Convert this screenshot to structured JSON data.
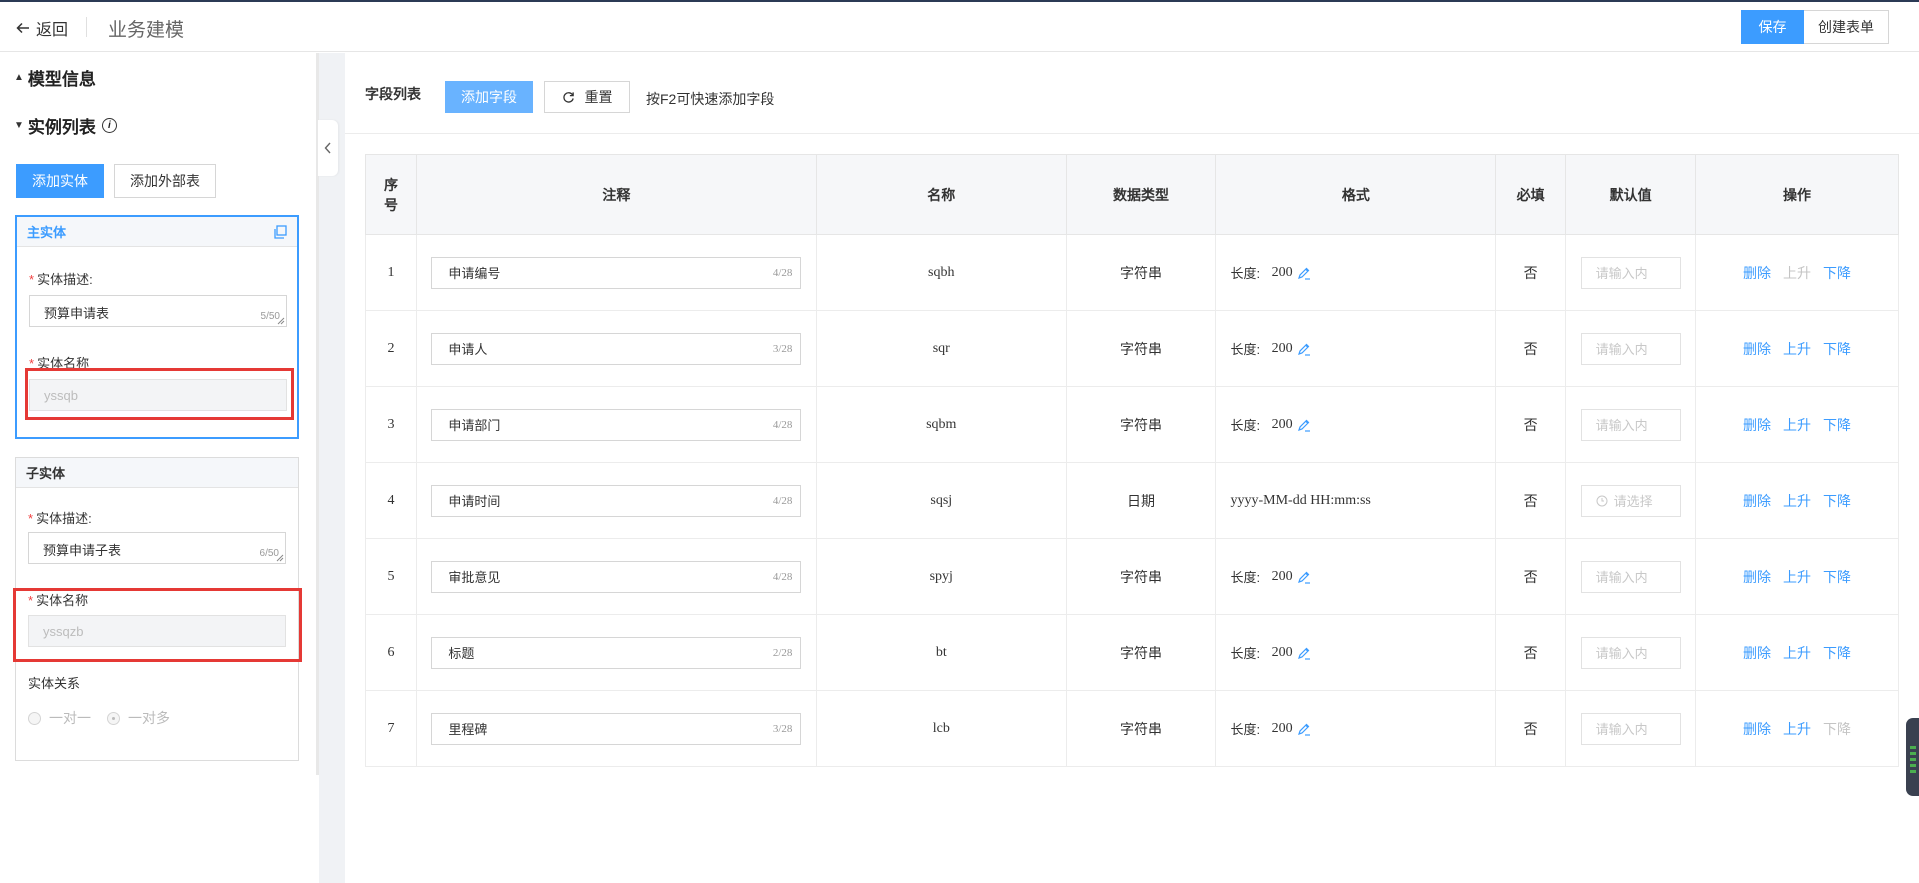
{
  "header": {
    "back_label": "返回",
    "title": "业务建模",
    "save_label": "保存",
    "create_form_label": "创建表单"
  },
  "sidebar": {
    "model_info_label": "模型信息",
    "instance_list_label": "实例列表",
    "add_entity_label": "添加实体",
    "add_external_label": "添加外部表",
    "main_entity": {
      "title": "主实体",
      "desc_label": "实体描述:",
      "desc_value": "预算申请表",
      "desc_count": "5/50",
      "name_label": "实体名称",
      "name_value": "yssqb"
    },
    "sub_entity": {
      "title": "子实体",
      "desc_label": "实体描述:",
      "desc_value": "预算申请子表",
      "desc_count": "6/50",
      "name_label": "实体名称",
      "name_value": "yssqzb",
      "relation_label": "实体关系",
      "options": [
        "一对一",
        "一对多"
      ],
      "selected": "一对多"
    }
  },
  "fields": {
    "title": "字段列表",
    "add_field_label": "添加字段",
    "reset_label": "重置",
    "hint": "按F2可快速添加字段",
    "columns": [
      "序号",
      "注释",
      "名称",
      "数据类型",
      "格式",
      "必填",
      "默认值",
      "操作"
    ],
    "index_col_chars": [
      "序",
      "号"
    ],
    "length_label": "长度:",
    "input_placeholder": "请输入内",
    "select_placeholder": "请选择",
    "op_delete": "删除",
    "op_up": "上升",
    "op_down": "下降",
    "rows": [
      {
        "idx": "1",
        "note": "申请编号",
        "count": "4/28",
        "name": "sqbh",
        "type": "字符串",
        "fmt_kind": "length",
        "fmt": "200",
        "required": "否",
        "default": "input",
        "up_enabled": false,
        "down_enabled": true
      },
      {
        "idx": "2",
        "note": "申请人",
        "count": "3/28",
        "name": "sqr",
        "type": "字符串",
        "fmt_kind": "length",
        "fmt": "200",
        "required": "否",
        "default": "input",
        "up_enabled": true,
        "down_enabled": true
      },
      {
        "idx": "3",
        "note": "申请部门",
        "count": "4/28",
        "name": "sqbm",
        "type": "字符串",
        "fmt_kind": "length",
        "fmt": "200",
        "required": "否",
        "default": "input",
        "up_enabled": true,
        "down_enabled": true
      },
      {
        "idx": "4",
        "note": "申请时间",
        "count": "4/28",
        "name": "sqsj",
        "type": "日期",
        "fmt_kind": "text",
        "fmt": "yyyy-MM-dd HH:mm:ss",
        "required": "否",
        "default": "select",
        "up_enabled": true,
        "down_enabled": true
      },
      {
        "idx": "5",
        "note": "审批意见",
        "count": "4/28",
        "name": "spyj",
        "type": "字符串",
        "fmt_kind": "length",
        "fmt": "200",
        "required": "否",
        "default": "input",
        "up_enabled": true,
        "down_enabled": true
      },
      {
        "idx": "6",
        "note": "标题",
        "count": "2/28",
        "name": "bt",
        "type": "字符串",
        "fmt_kind": "length",
        "fmt": "200",
        "required": "否",
        "default": "input",
        "up_enabled": true,
        "down_enabled": true
      },
      {
        "idx": "7",
        "note": "里程碑",
        "count": "3/28",
        "name": "lcb",
        "type": "字符串",
        "fmt_kind": "length",
        "fmt": "200",
        "required": "否",
        "default": "input",
        "up_enabled": true,
        "down_enabled": false
      }
    ]
  },
  "colors": {
    "accent": "#3c9cff",
    "highlight_box": "#e53935"
  }
}
